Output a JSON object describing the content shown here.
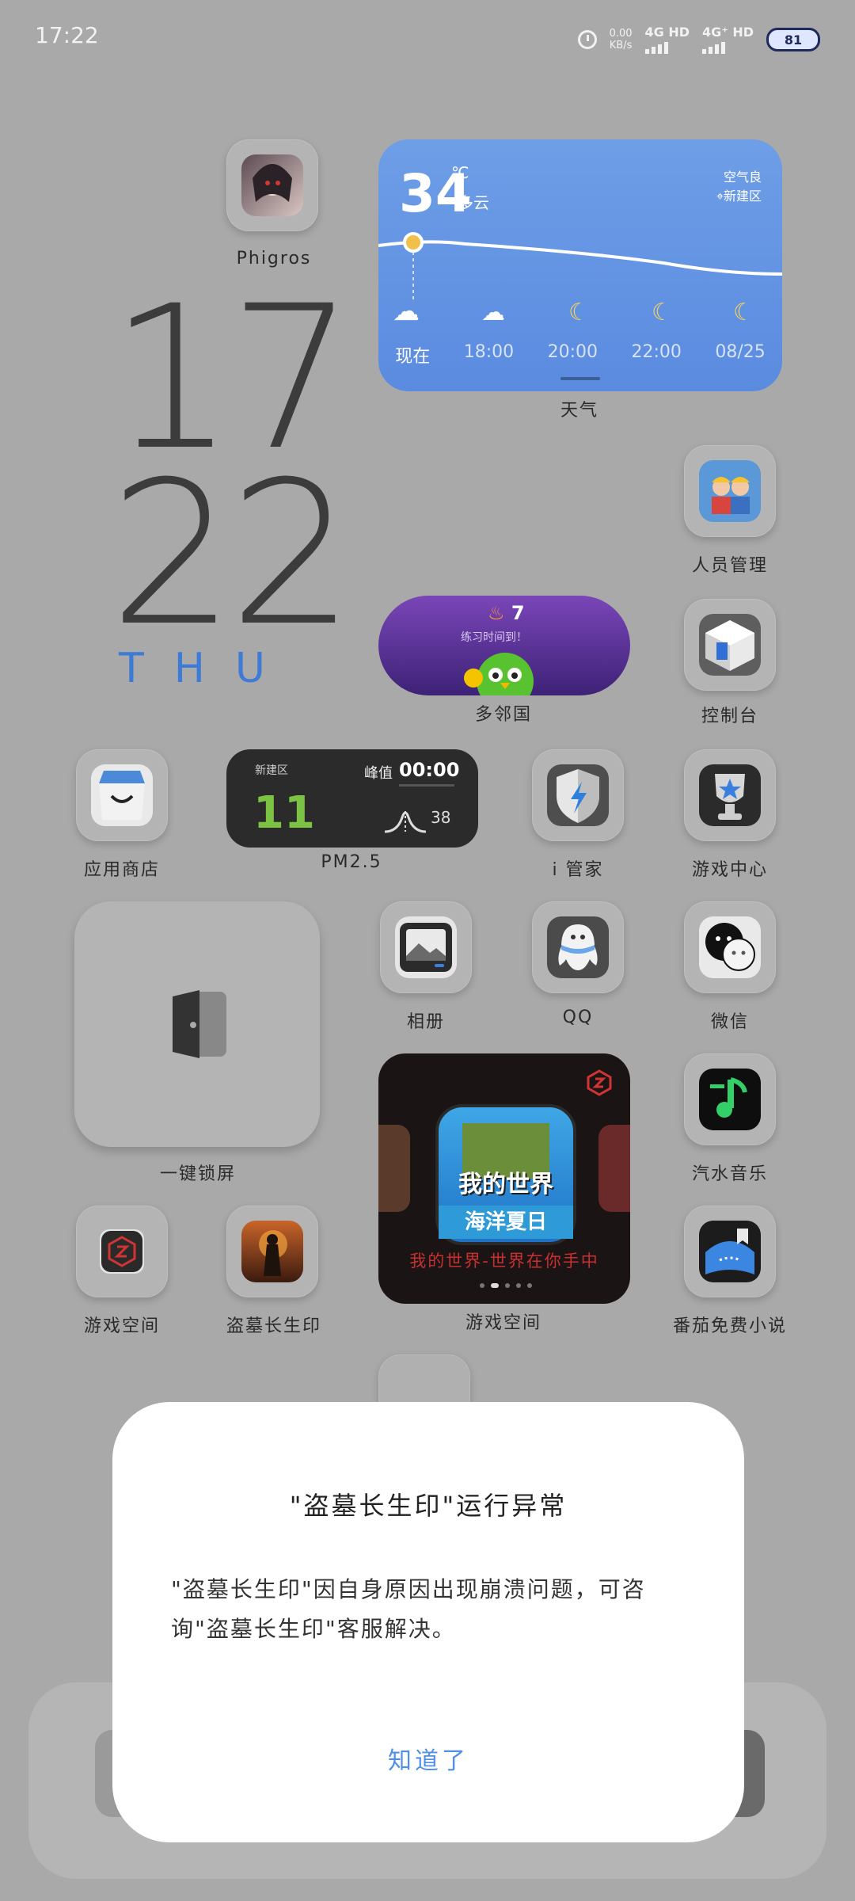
{
  "status_bar": {
    "time": "17:22",
    "net_speed_value": "0.00",
    "net_speed_unit": "KB/s",
    "sim1_label": "4G HD",
    "sim2_label": "4G⁺ HD",
    "battery": "81"
  },
  "clock": {
    "hour": "17",
    "minute": "22",
    "weekday": "THU"
  },
  "apps": {
    "phigros": "Phigros",
    "weather_label": "天气",
    "staff": "人员管理",
    "duolingo": "多邻国",
    "console": "控制台",
    "appstore": "应用商店",
    "pm_label": "PM2.5",
    "iguanjia": "i 管家",
    "gamecenter": "游戏中心",
    "album": "相册",
    "qq": "QQ",
    "wechat": "微信",
    "onekeylock": "一键锁屏",
    "qishui": "汽水音乐",
    "gamespace1": "游戏空间",
    "daomu": "盗墓长生印",
    "gamespace_widget_label": "游戏空间",
    "fanqie": "番茄免费小说"
  },
  "weather": {
    "temp": "34",
    "unit": "℃",
    "condition": "多云",
    "air_quality": "空气良",
    "location": "新建区",
    "times": [
      "现在",
      "18:00",
      "20:00",
      "22:00",
      "08/25"
    ]
  },
  "duo_widget": {
    "streak": "7",
    "message": "练习时间到！"
  },
  "pm_widget": {
    "location": "新建区",
    "peak_label": "峰值",
    "peak_time": "00:00",
    "value": "11",
    "peak_value": "38"
  },
  "game_widget": {
    "title_art": "我的世界",
    "subtitle_art": "海洋夏日",
    "caption": "我的世界-世界在你手中"
  },
  "dialog": {
    "title": "\"盗墓长生印\"运行异常",
    "body": "\"盗墓长生印\"因自身原因出现崩溃问题，可咨询\"盗墓长生印\"客服解决。",
    "button": "知道了"
  },
  "colors": {
    "background": "#a9a9a9",
    "accent_blue": "#4f90e6",
    "weekday_blue": "#3d7bd6"
  }
}
